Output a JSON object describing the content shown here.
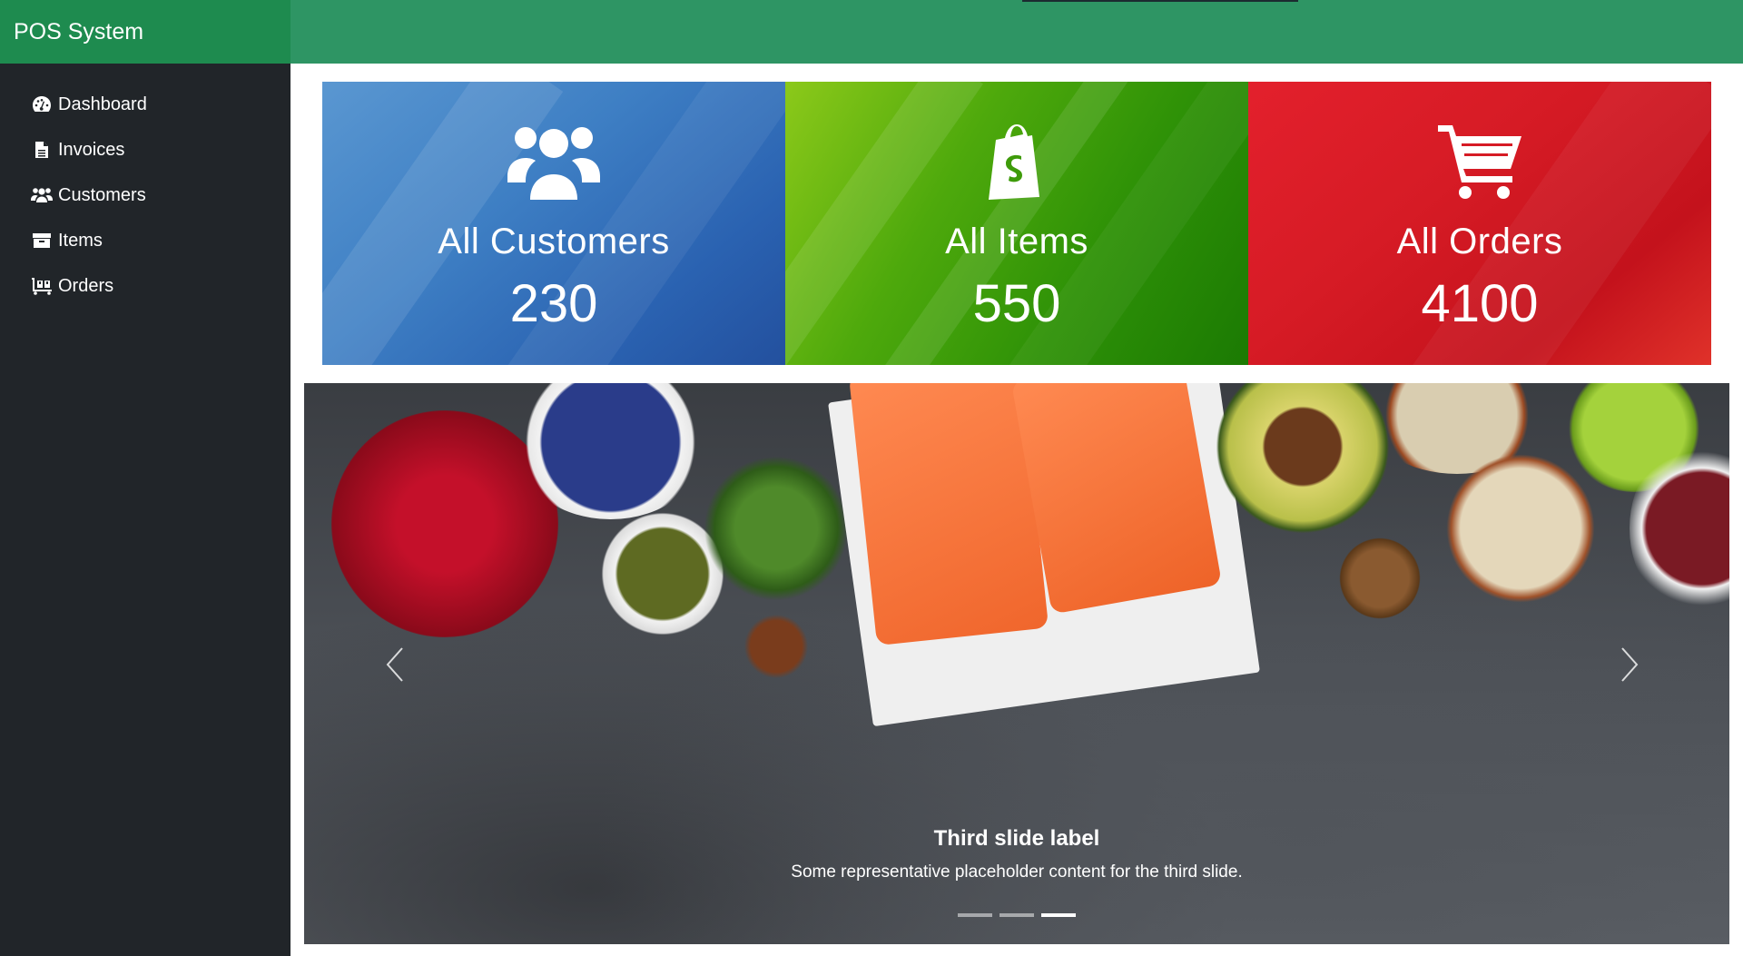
{
  "app": {
    "title": "POS System"
  },
  "sidebar": {
    "items": [
      {
        "label": "Dashboard",
        "icon": "dashboard-icon"
      },
      {
        "label": "Invoices",
        "icon": "file-icon"
      },
      {
        "label": "Customers",
        "icon": "users-icon"
      },
      {
        "label": "Items",
        "icon": "archive-icon"
      },
      {
        "label": "Orders",
        "icon": "dolly-icon"
      }
    ]
  },
  "cards": [
    {
      "title": "All Customers",
      "value": "230",
      "icon": "users-icon",
      "color": "#3e7fc4"
    },
    {
      "title": "All Items",
      "value": "550",
      "icon": "shopify-bag-icon",
      "color": "#3e9b0a"
    },
    {
      "title": "All Orders",
      "value": "4100",
      "icon": "shopping-cart-icon",
      "color": "#d61b25"
    }
  ],
  "carousel": {
    "caption_title": "Third slide label",
    "caption_text": "Some representative placeholder content for the third slide.",
    "slide_count": 3,
    "active_slide": 3
  },
  "colors": {
    "brand": "#1e8b4f",
    "topbar": "#2e9564",
    "sidebar": "#212529"
  }
}
